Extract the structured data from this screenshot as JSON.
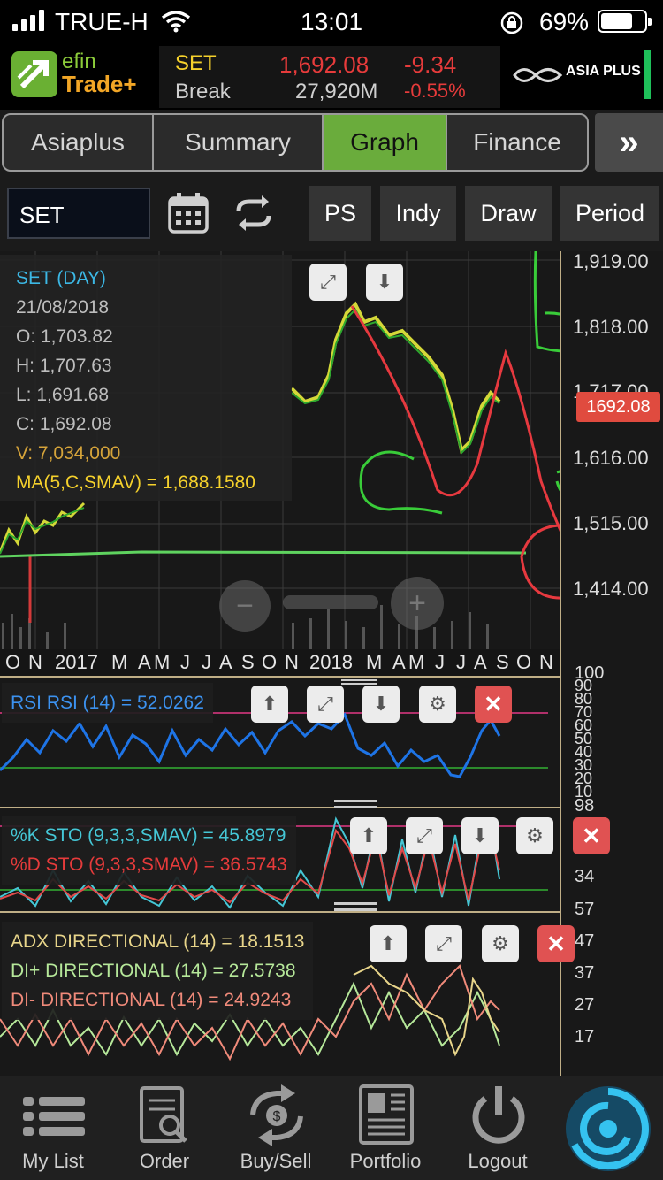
{
  "status_bar": {
    "carrier": "TRUE-H",
    "time": "13:01",
    "battery": "69%"
  },
  "header": {
    "logo_top": "efin",
    "logo_bottom": "Trade+",
    "symbol": "SET",
    "price": "1,692.08",
    "change": "-9.34",
    "label": "Break",
    "volume": "27,920M",
    "change_pct": "-0.55%",
    "broker": "ASIA PLUS"
  },
  "tabs": [
    {
      "label": "Asiaplus"
    },
    {
      "label": "Summary"
    },
    {
      "label": "Graph"
    },
    {
      "label": "Finance"
    }
  ],
  "toolbar": {
    "symbol_value": "SET",
    "ps": "PS",
    "indy": "Indy",
    "draw": "Draw",
    "period": "Period"
  },
  "price_axis": [
    "1,919.00",
    "1,818.00",
    "1,717.00",
    "1,616.00",
    "1,515.00",
    "1,414.00"
  ],
  "price_tag": "1692.08",
  "info": {
    "title": "SET (DAY)",
    "date": "21/08/2018",
    "open": "O: 1,703.82",
    "high": "H: 1,707.63",
    "low": "L: 1,691.68",
    "close": "C: 1,692.08",
    "volume": "V: 7,034,000",
    "ma": "MA(5,C,SMAV) = 1,688.1580"
  },
  "months": [
    "O",
    "N",
    "2017",
    "M",
    "A",
    "M",
    "J",
    "J",
    "A",
    "S",
    "O",
    "N",
    "2018",
    "M",
    "A",
    "M",
    "J",
    "J",
    "A",
    "S",
    "O",
    "N"
  ],
  "rsi": {
    "label": "RSI RSI (14) = 52.0262",
    "axis": [
      "100",
      "90",
      "80",
      "70",
      "60",
      "50",
      "40",
      "30",
      "20",
      "10"
    ]
  },
  "sto": {
    "k_label": "%K STO (9,3,3,SMAV) = 45.8979",
    "d_label": "%D STO (9,3,3,SMAV) = 36.5743",
    "axis": [
      "98",
      "34"
    ]
  },
  "adx": {
    "adx_label": "ADX DIRECTIONAL (14) = 18.1513",
    "di_plus_label": "DI+ DIRECTIONAL (14) = 27.5738",
    "di_minus_label": "DI- DIRECTIONAL (14) = 24.9243",
    "axis": [
      "57",
      "47",
      "37",
      "27",
      "17"
    ]
  },
  "bottom_nav": [
    {
      "label": "My List"
    },
    {
      "label": "Order"
    },
    {
      "label": "Buy/Sell"
    },
    {
      "label": "Portfolio"
    },
    {
      "label": "Logout"
    }
  ],
  "colors": {
    "accent_green": "#6aac3c",
    "price_red": "#e63b3b",
    "rsi_blue": "#1e74e6",
    "info_title": "#3cb8e5",
    "ma_yellow": "#f5d12c"
  }
}
